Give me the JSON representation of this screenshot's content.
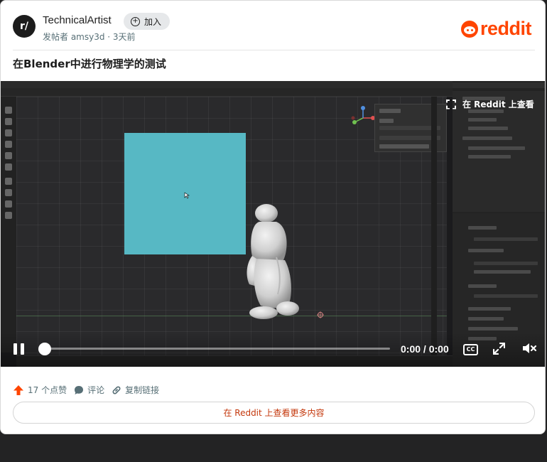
{
  "post": {
    "community_name": "TechnicalArtist",
    "avatar_glyph": "r/",
    "join_label": "加入",
    "meta": "发帖者 amsy3d · 3天前",
    "title": "在Blender中进行物理学的测试",
    "brand": "reddit"
  },
  "video": {
    "view_on_reddit": "在 Reddit 上查看",
    "time_current": "0:00",
    "time_separator": " / ",
    "time_total": "0:00",
    "cc_label": "CC",
    "progress": 0.0,
    "muted": true
  },
  "actions": {
    "upvotes": "17 个点赞",
    "comment": "评论",
    "copy_link": "复制链接"
  },
  "more_button": "在 Reddit 上查看更多内容",
  "colors": {
    "brand_orange": "#ff4500",
    "link_orange": "#c4380c",
    "box_cyan": "#57b8c4"
  }
}
